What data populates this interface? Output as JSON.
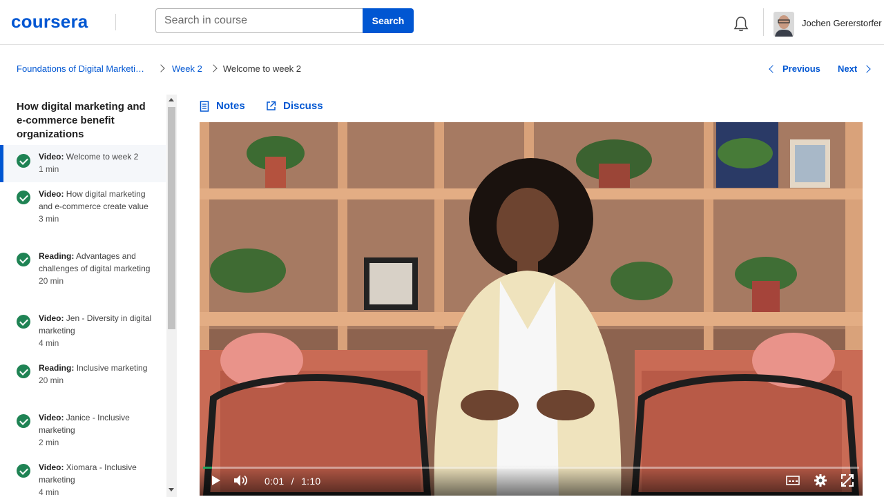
{
  "header": {
    "logo": "coursera",
    "search_placeholder": "Search in course",
    "search_button": "Search",
    "user_name": "Jochen Gererstorfer"
  },
  "breadcrumb": {
    "course": "Foundations of Digital Marketi…",
    "week": "Week 2",
    "current": "Welcome to week 2"
  },
  "nav": {
    "previous": "Previous",
    "next": "Next"
  },
  "sidebar": {
    "module_title": "How digital marketing and e-commerce benefit organizations",
    "items": [
      {
        "type": "Video:",
        "title": "Welcome to week 2",
        "duration": "1 min",
        "status": "completed",
        "active": true
      },
      {
        "type": "Video:",
        "title": "How digital marketing and e-commerce create value",
        "duration": "3 min",
        "status": "completed"
      },
      {
        "type": "Reading:",
        "title": "Advantages and challenges of digital marketing",
        "duration": "20 min",
        "status": "completed"
      },
      {
        "type": "Video:",
        "title": "Jen - Diversity in digital marketing",
        "duration": "4 min",
        "status": "completed"
      },
      {
        "type": "Reading:",
        "title": "Inclusive marketing",
        "duration": "20 min",
        "status": "completed"
      },
      {
        "type": "Video:",
        "title": "Janice - Inclusive marketing",
        "duration": "2 min",
        "status": "completed"
      },
      {
        "type": "Video:",
        "title": "Xiomara - Inclusive marketing",
        "duration": "4 min",
        "status": "completed"
      }
    ]
  },
  "tabs": {
    "notes": "Notes",
    "discuss": "Discuss"
  },
  "player": {
    "current_time": "0:01",
    "separator": "/",
    "duration": "1:10",
    "progress_fraction": 0.014
  },
  "colors": {
    "brand": "#0056d2",
    "complete": "#1f8354",
    "progress": "#25a55f"
  }
}
